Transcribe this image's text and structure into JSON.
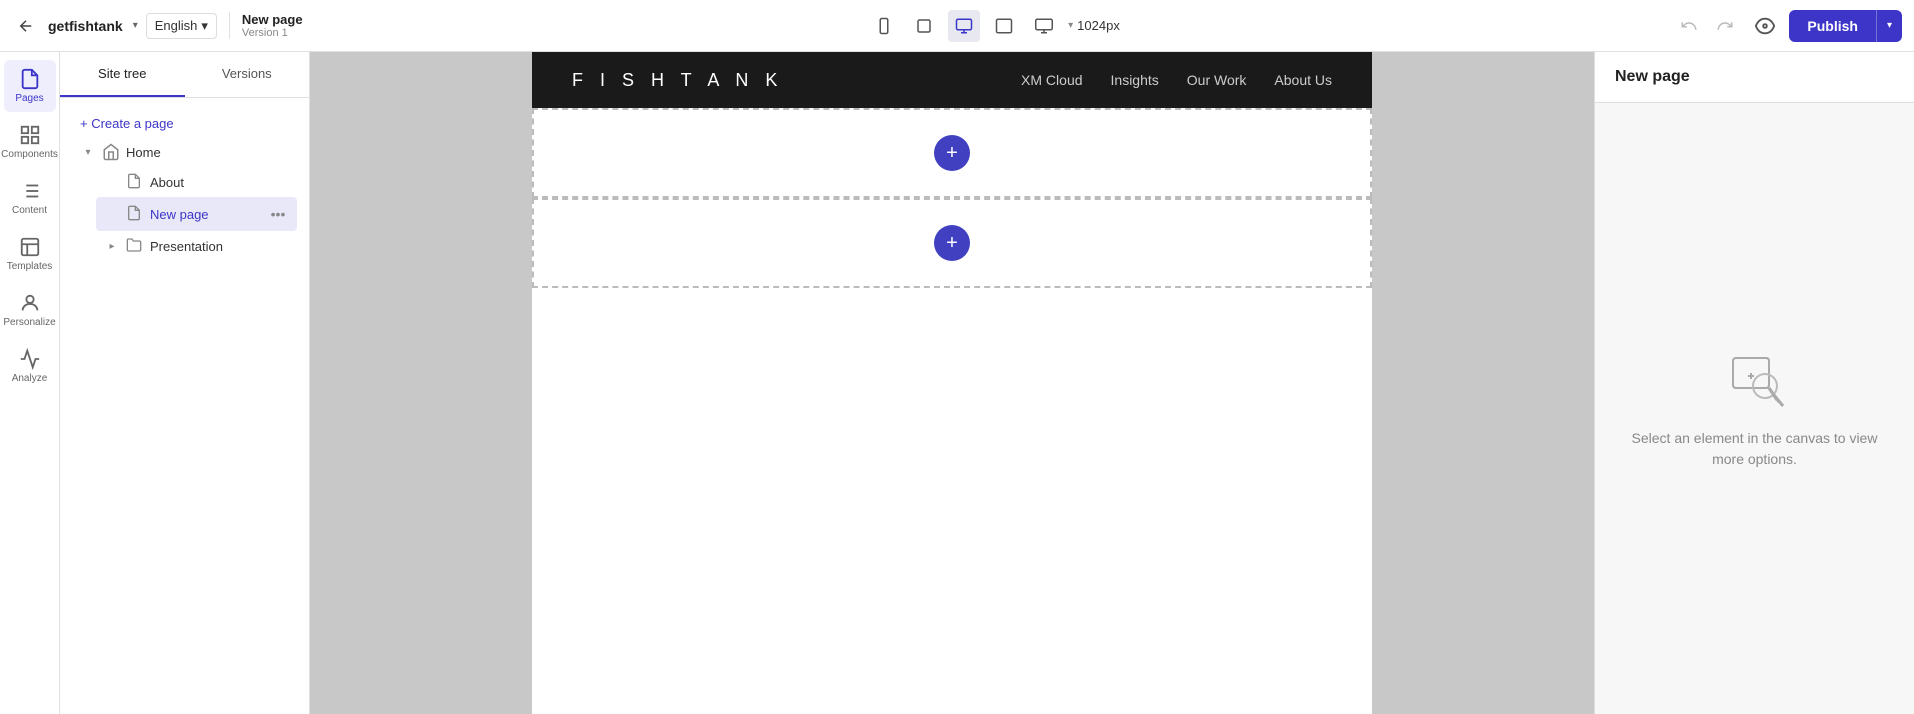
{
  "toolbar": {
    "back_label": "←",
    "site_name": "getfishtank",
    "site_name_arrow": "▾",
    "language": "English",
    "language_arrow": "▾",
    "page_title": "New page",
    "page_version": "Version 1",
    "devices": [
      {
        "name": "mobile",
        "icon": "mobile"
      },
      {
        "name": "tablet-sm",
        "icon": "tablet-sm"
      },
      {
        "name": "desktop",
        "icon": "desktop"
      },
      {
        "name": "tablet-lg",
        "icon": "tablet-lg"
      },
      {
        "name": "monitor",
        "icon": "monitor"
      }
    ],
    "resolution_arrow": "▾",
    "resolution": "1024px",
    "undo_label": "↺",
    "redo_label": "↻",
    "preview_label": "👁",
    "publish_label": "Publish",
    "publish_arrow": "▾"
  },
  "sidebar": {
    "items": [
      {
        "label": "Pages",
        "active": true
      },
      {
        "label": "Components",
        "active": false
      },
      {
        "label": "Content",
        "active": false
      },
      {
        "label": "Templates",
        "active": false
      },
      {
        "label": "Personalize",
        "active": false
      },
      {
        "label": "Analyze",
        "active": false
      }
    ]
  },
  "panel": {
    "tabs": [
      {
        "label": "Site tree",
        "active": true
      },
      {
        "label": "Versions",
        "active": false
      }
    ],
    "create_page_label": "+ Create a page",
    "tree": [
      {
        "label": "Home",
        "hasToggle": true,
        "toggleOpen": true,
        "indent": 0,
        "children": [
          {
            "label": "About",
            "hasToggle": false,
            "indent": 1
          },
          {
            "label": "New page",
            "hasToggle": false,
            "indent": 1,
            "selected": true,
            "hasMore": true
          },
          {
            "label": "Presentation",
            "hasToggle": true,
            "toggleOpen": false,
            "indent": 1
          }
        ]
      }
    ]
  },
  "canvas": {
    "site_logo": "F  I  S  H  T  A  N  K",
    "site_nav": [
      "XM Cloud",
      "Insights",
      "Our Work",
      "About Us"
    ],
    "sections": [
      {
        "add_btn": "+"
      },
      {
        "add_btn": "+"
      }
    ]
  },
  "right_panel": {
    "title": "New page",
    "help_text": "Select an element in the canvas to view more options."
  }
}
